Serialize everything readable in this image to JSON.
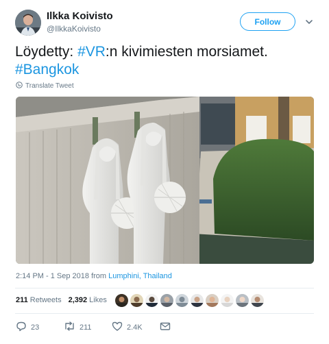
{
  "author": {
    "name": "Ilkka Koivisto",
    "handle": "@IlkkaKoivisto"
  },
  "follow_label": "Follow",
  "tweet": {
    "text_prefix": "Löydetty: ",
    "hashtag1": "#VR",
    "text_middle": ":n kivimiesten morsiamet.",
    "hashtag2": "#Bangkok"
  },
  "translate_label": "Translate Tweet",
  "timestamp": {
    "time": "2:14 PM - 1 Sep 2018 from ",
    "location": "Lumphini, Thailand"
  },
  "stats": {
    "retweets_count": "211",
    "retweets_label": "Retweets",
    "likes_count": "2,392",
    "likes_label": "Likes"
  },
  "actions": {
    "replies": "23",
    "retweets": "211",
    "likes": "2.4K"
  },
  "colors": {
    "accent": "#1da1f2",
    "link": "#1b95e0",
    "muted": "#657786"
  }
}
